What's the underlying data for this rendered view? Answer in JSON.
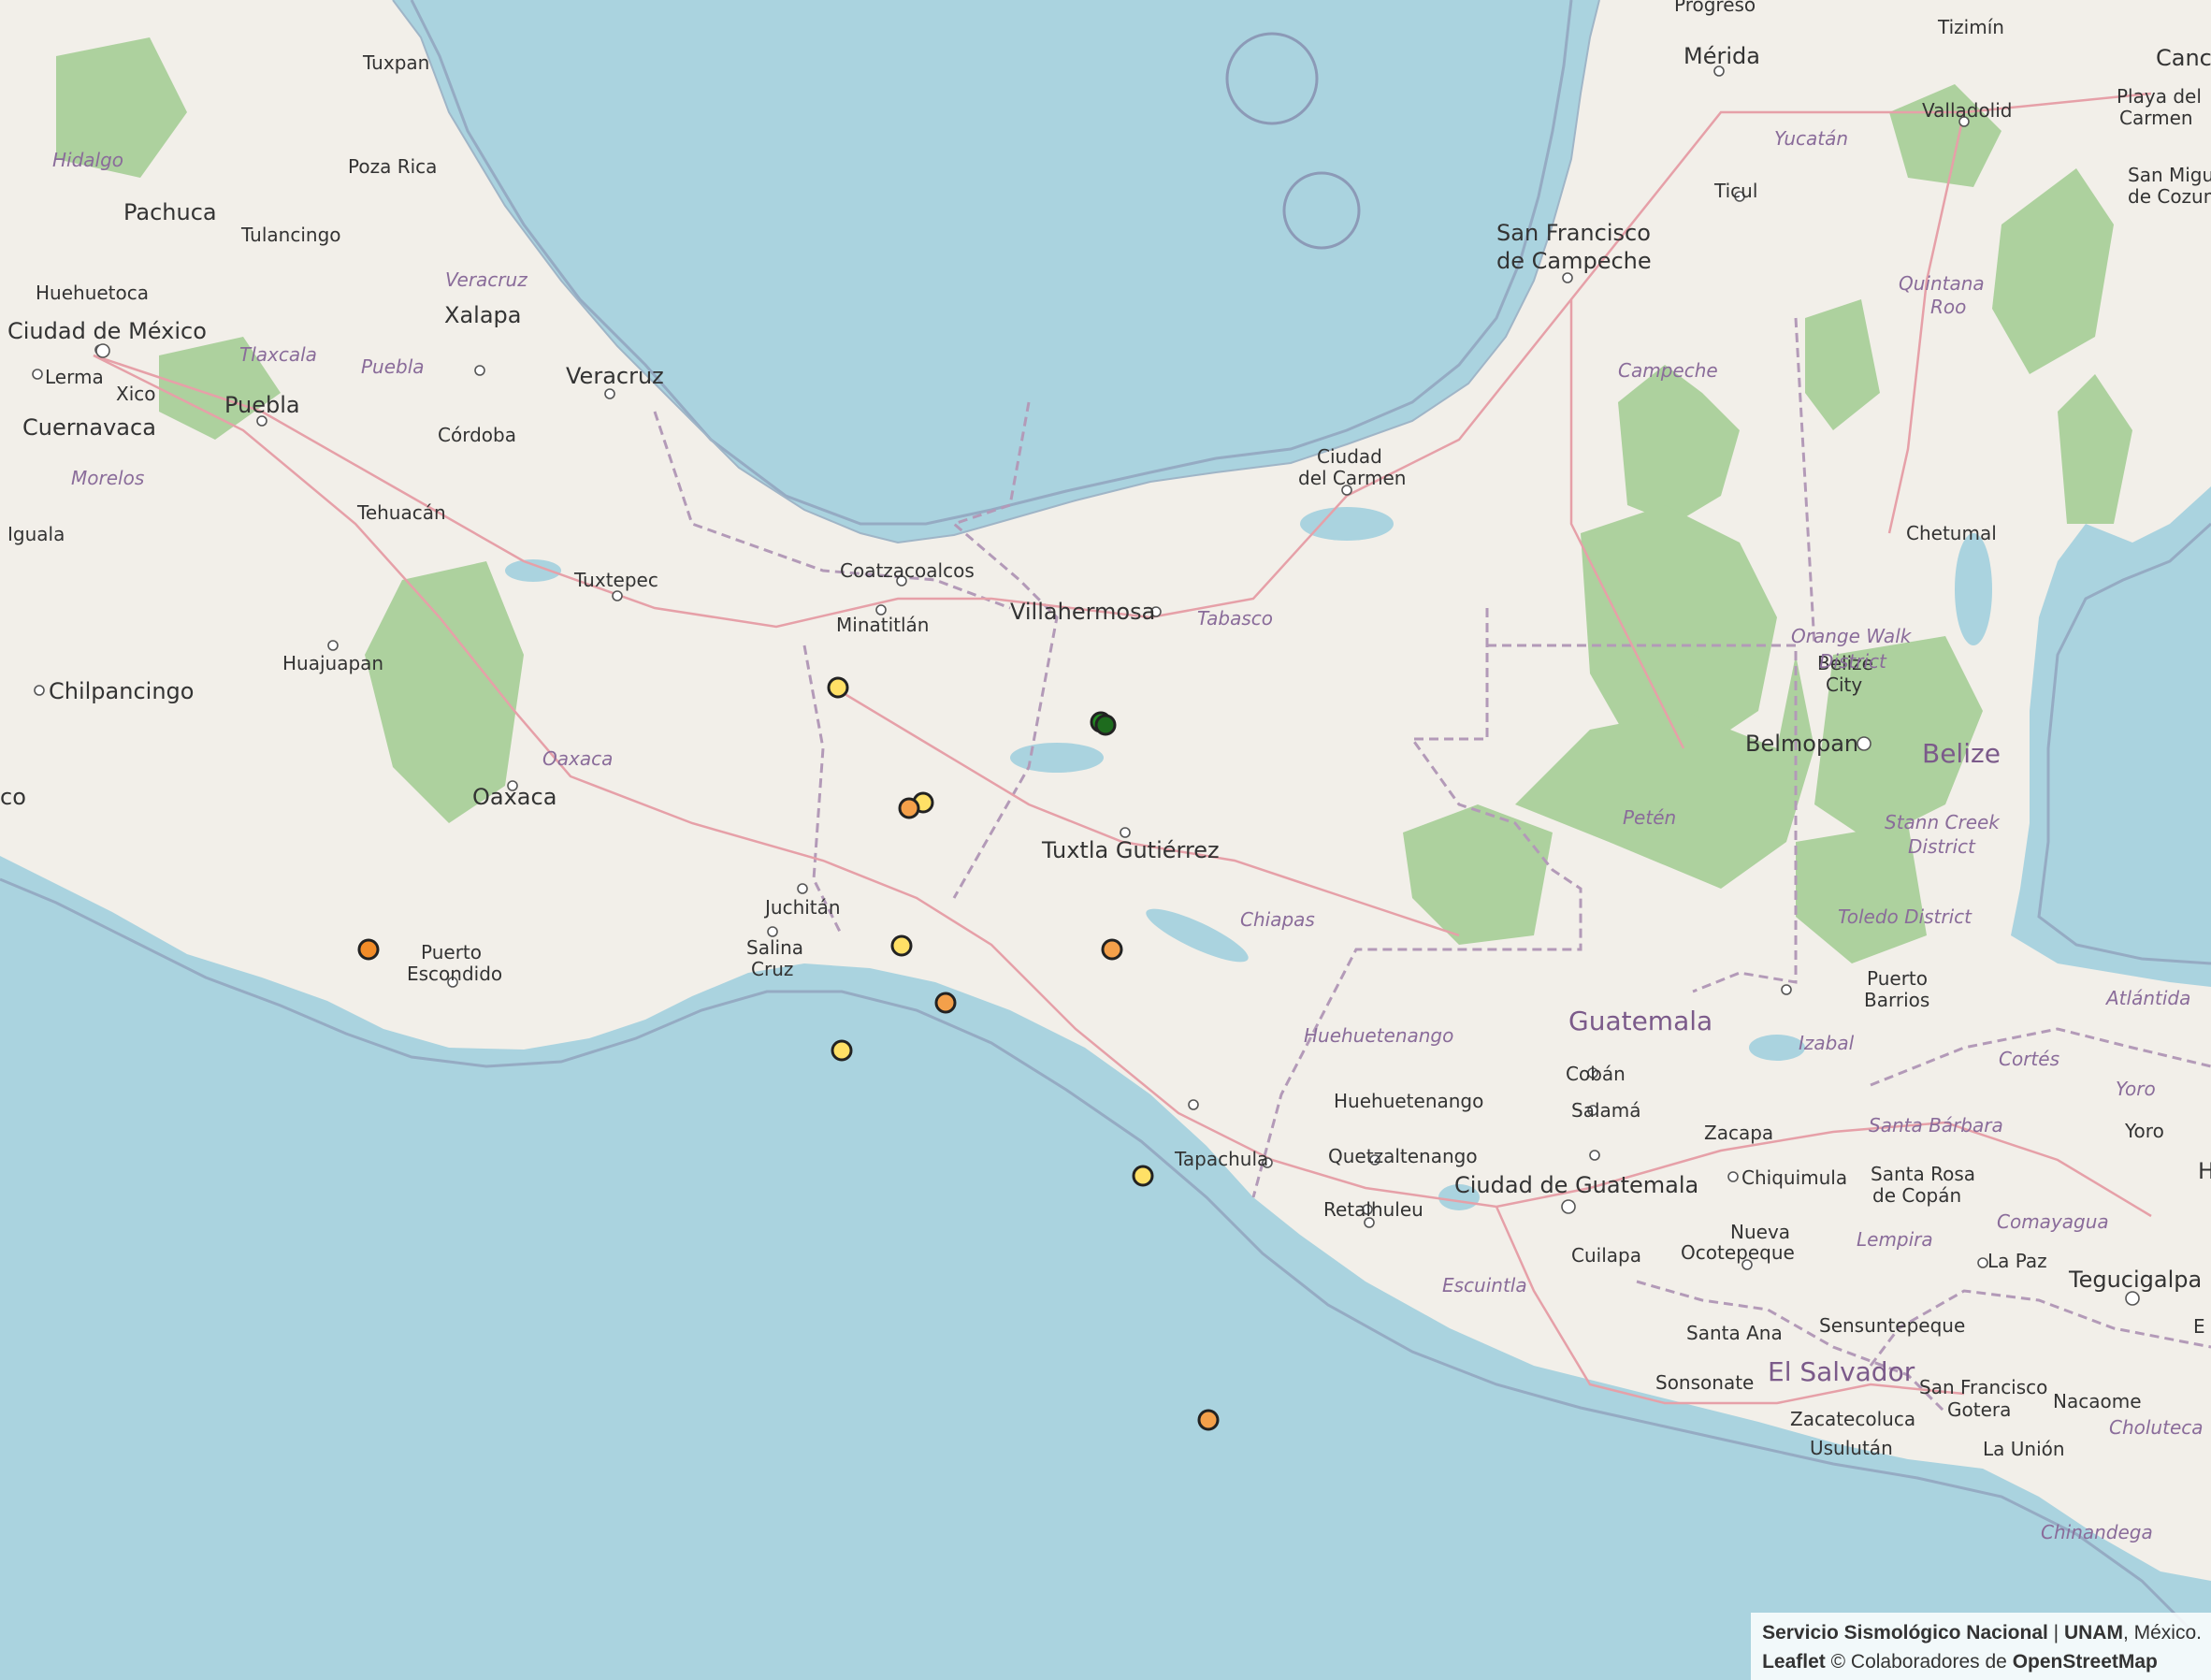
{
  "map": {
    "labels": {
      "progreso": "Progreso",
      "merida": "Mérida",
      "tizimin": "Tizimín",
      "cancun": "Canc",
      "valladolid": "Valladolid",
      "playa": "Playa del Carmen",
      "playa_1": "Playa del",
      "playa_2": "Carmen",
      "sanmiguel_1": "San Migu",
      "sanmiguel_2": "de Cozum",
      "yucatan": "Yucatán",
      "ticul": "Ticul",
      "campeche_1": "San Francisco",
      "campeche_2": "de Campeche",
      "qroo_1": "Quintana",
      "qroo_2": "Roo",
      "campeche_state": "Campeche",
      "carmen_1": "Ciudad",
      "carmen_2": "del Carmen",
      "chetumal": "Chetumal",
      "tuxpan": "Tuxpan",
      "hidalgo": "Hidalgo",
      "pozarica": "Poza Rica",
      "pachuca": "Pachuca",
      "tulancingo": "Tulancingo",
      "veracruz_state": "Veracruz",
      "huehuetoca": "Huehuetoca",
      "xalapa": "Xalapa",
      "cdmx": "Ciudad de México",
      "tlaxcala": "Tlaxcala",
      "puebla_state": "Puebla",
      "veracruz": "Veracruz",
      "lerma": "Lerma",
      "xico": "Xico",
      "puebla": "Puebla",
      "cuernavaca": "Cuernavaca",
      "cordoba": "Córdoba",
      "morelos": "Morelos",
      "tehuacan": "Tehuacán",
      "iguala": "Iguala",
      "coatzacoalcos": "Coatzacoalcos",
      "tuxtepec": "Tuxtepec",
      "villahermosa": "Villahermosa",
      "tabasco": "Tabasco",
      "minatitlan": "Minatitlán",
      "huajuapan": "Huajuapan",
      "chilpancingo": "Chilpancingo",
      "oaxaca_state": "Oaxaca",
      "oaxaca": "Oaxaca",
      "aco": "co",
      "tuxtla": "Tuxtla Gutiérrez",
      "orangewalk_1": "Orange Walk",
      "orangewalk_2": "District",
      "belizecity_1": "Belize",
      "belizecity_2": "City",
      "belmopan": "Belmopan",
      "belize": "Belize",
      "peten": "Petén",
      "stanncreek_1": "Stann Creek",
      "stanncreek_2": "District",
      "juchitan": "Juchitán",
      "chiapas": "Chiapas",
      "toledo": "Toledo District",
      "salinacruz_1": "Salina",
      "salinacruz_2": "Cruz",
      "puertoesc_1": "Puerto",
      "puertoesc_2": "Escondido",
      "puertobarrios_1": "Puerto",
      "puertobarrios_2": "Barrios",
      "atlantida": "Atlántida",
      "guatemala": "Guatemala",
      "huehue_state": "Huehuetenango",
      "izabal": "Izabal",
      "coban": "Cobán",
      "cortes": "Cortés",
      "huehue": "Huehuetenango",
      "salama": "Salamá",
      "yoro_state": "Yoro",
      "zacapa": "Zacapa",
      "santabarbara": "Santa Bárbara",
      "yoro": "Yoro",
      "tapachula": "Tapachula",
      "quetzaltenango": "Quetzaltenango",
      "chiquimula": "Chiquimula",
      "santarosa_1": "Santa Rosa",
      "santarosa_2": "de Copán",
      "h": "H",
      "cdguatemala": "Ciudad de Guatemala",
      "retalhuleu": "Retalhuleu",
      "comayagua": "Comayagua",
      "lempira": "Lempira",
      "nuevaocot_1": "Nueva",
      "nuevaocot_2": "Ocotepeque",
      "cuilapa": "Cuilapa",
      "lapaz": "La Paz",
      "escuintla": "Escuintla",
      "tegucigalpa": "Tegucigalpa",
      "santaana": "Santa Ana",
      "sensuntepeque": "Sensuntepeque",
      "e": "E",
      "elsalvador": "El Salvador",
      "sonsonate": "Sonsonate",
      "sanfrancgotera_1": "San Francisco",
      "sanfrancgotera_2": "Gotera",
      "nacaome": "Nacaome",
      "zacatecoluca": "Zacatecoluca",
      "choluteca": "Choluteca",
      "usulutan": "Usulután",
      "launion": "La Unión",
      "chinandega": "Chinandega"
    },
    "markers": [
      {
        "id": "q1",
        "color": "#ffe066"
      },
      {
        "id": "q2",
        "color": "#ffe066"
      },
      {
        "id": "q3",
        "color": "#f4a04a"
      },
      {
        "id": "q4",
        "color": "#228b22"
      },
      {
        "id": "q5",
        "color": "#1e6b1e"
      },
      {
        "id": "q6",
        "color": "#f28c28"
      },
      {
        "id": "q7",
        "color": "#ffe066"
      },
      {
        "id": "q8",
        "color": "#f4a04a"
      },
      {
        "id": "q9",
        "color": "#f4a04a"
      },
      {
        "id": "q10",
        "color": "#ffe066"
      },
      {
        "id": "q11",
        "color": "#ffe066"
      },
      {
        "id": "q12",
        "color": "#f4a04a"
      }
    ]
  },
  "attribution": {
    "line1_a": "Servicio Sismológico Nacional",
    "line1_sep": " | ",
    "line1_b": "UNAM",
    "line1_c": ", México.",
    "line2_a": "Leaflet",
    "line2_b": " © Colaboradores de ",
    "line2_c": "OpenStreetMap"
  }
}
